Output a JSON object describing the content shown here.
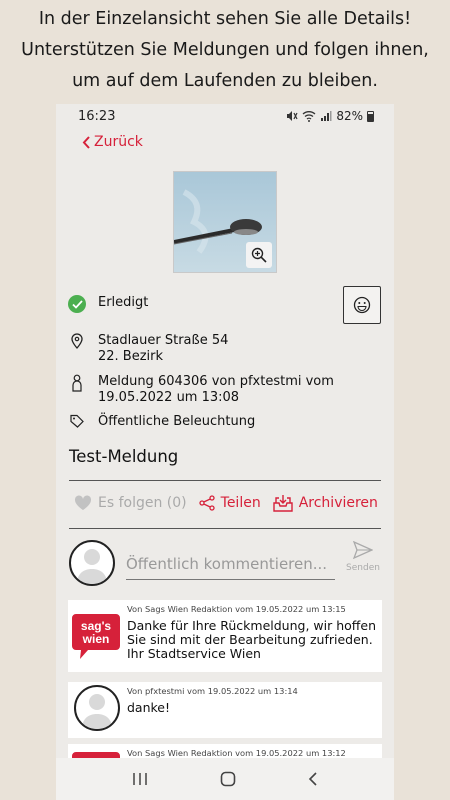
{
  "caption": {
    "line1": "In der Einzelansicht sehen Sie alle Details!",
    "line2": "Unterstützen Sie Meldungen und folgen ihnen,",
    "line3": "um auf dem Laufenden zu bleiben."
  },
  "statusbar": {
    "time": "16:23",
    "battery": "82%"
  },
  "nav": {
    "back_label": "Zurück"
  },
  "report": {
    "status": "Erledigt",
    "address_line1": "Stadlauer Straße 54",
    "address_line2": "22. Bezirk",
    "reporter_line1": "Meldung 604306 von pfxtestmi vom",
    "reporter_line2": "19.05.2022 um 13:08",
    "category": "Öffentliche Beleuchtung",
    "title": "Test-Meldung"
  },
  "actions": {
    "follow_label": "Es folgen (0)",
    "share_label": "Teilen",
    "archive_label": "Archivieren"
  },
  "comment_box": {
    "placeholder": "Öffentlich kommentieren...",
    "send_label": "Senden"
  },
  "comments": [
    {
      "author_line": "Von Sags Wien Redaktion vom 19.05.2022 um 13:15",
      "text": "Danke für Ihre Rückmeldung, wir hoffen Sie sind mit der Bearbeitung zufrieden. Ihr Stadtservice Wien",
      "logo_top": "sag's",
      "logo_bottom": "wien"
    },
    {
      "author_line": "Von pfxtestmi vom 19.05.2022 um 13:14",
      "text": "danke!"
    },
    {
      "author_line": "Von Sags Wien Redaktion vom 19.05.2022 um 13:12"
    }
  ],
  "colors": {
    "accent": "#d6213a",
    "success": "#4caf50",
    "background": "#e9e2d8"
  }
}
